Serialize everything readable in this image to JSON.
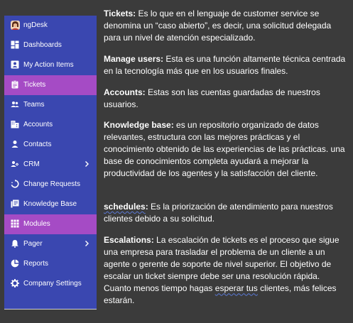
{
  "sidebar": {
    "app_name": "ngDesk",
    "items": [
      {
        "label": "Dashboards",
        "icon": "dashboard-icon"
      },
      {
        "label": "My Action Items",
        "icon": "contact-card-icon"
      },
      {
        "label": "Tickets",
        "icon": "clipboard-icon",
        "active": true
      },
      {
        "label": "Teams",
        "icon": "people-icon"
      },
      {
        "label": "Accounts",
        "icon": "building-icon"
      },
      {
        "label": "Contacts",
        "icon": "person-icon"
      },
      {
        "label": "CRM",
        "icon": "people-network-icon",
        "expandable": true
      },
      {
        "label": "Change Requests",
        "icon": "refresh-circle-icon"
      },
      {
        "label": "Knowledge Base",
        "icon": "book-icon"
      },
      {
        "label": "Modules",
        "icon": "grid-icon",
        "active": true
      },
      {
        "label": "Pager",
        "icon": "bell-icon",
        "expandable": true
      },
      {
        "label": "Reports",
        "icon": "pie-chart-icon"
      },
      {
        "label": "Company Settings",
        "icon": "gear-icon"
      }
    ]
  },
  "content": {
    "tickets": {
      "term": "Tickets:",
      "text": " Es lo que en el lenguaje de customer service se denomina un “caso abierto”, es decir, una solicitud delegada para un nivel de atención especializado."
    },
    "manage_users": {
      "term": "Manage users:",
      "text": " Esta es una función altamente técnica centrada en la tecnología más que en los usuarios finales."
    },
    "accounts": {
      "term": "Accounts:",
      "text": " Estas son las cuentas guardadas de nuestros usuarios."
    },
    "knowledge_base": {
      "term": "Knowledge base:",
      "text": " es un repositorio organizado de datos relevantes, estructura con las mejores prácticas y el conocimiento obtenido de las  experiencias de las prácticas. una base de conocimientos completa ayudará a mejorar la productividad de los agentes y la satisfacción del cliente."
    },
    "schedules": {
      "term": "schedules",
      "term_suffix": ":",
      "text": " Es la priorización de atendimiento para nuestros clientes debido a su solicitud."
    },
    "escalations": {
      "term": "Escalations:",
      "text_before": " La escalación de tickets es el proceso que sigue una empresa para trasladar el problema de un cliente a un agente o gerente de soporte de nivel superior. El objetivo de escalar un ticket siempre debe ser una resolución rápida. Cuanto menos tiempo hagas ",
      "text_underlined": "esperar tus",
      "text_after": " clientes, más felices estarán."
    }
  }
}
